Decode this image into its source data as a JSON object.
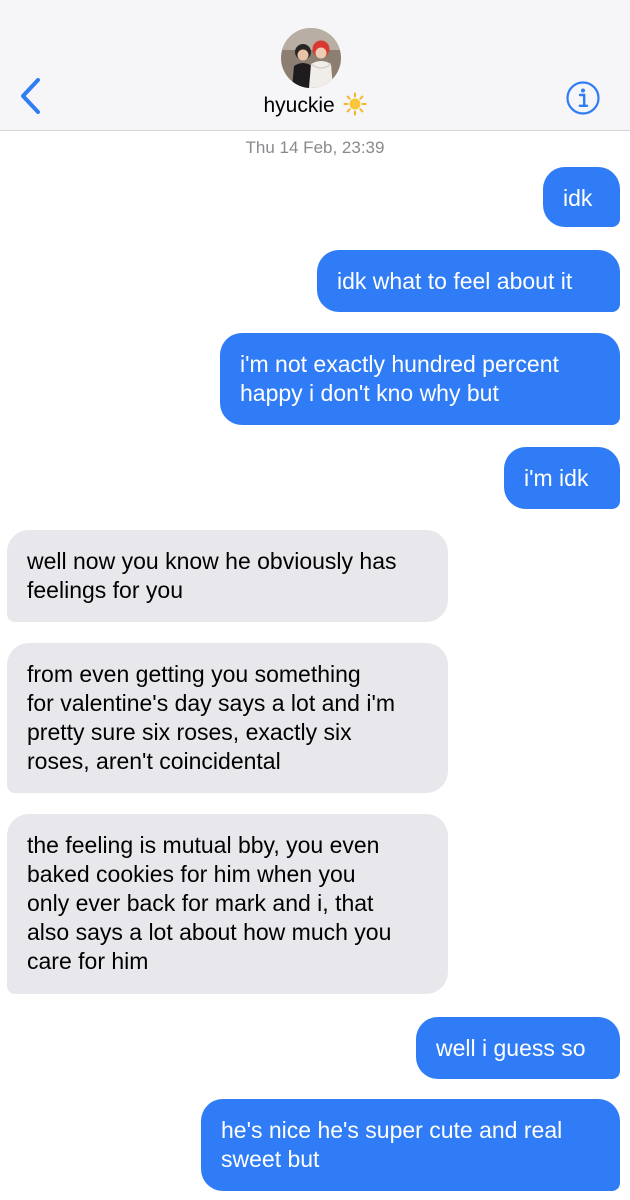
{
  "header": {
    "contact_name": "hyuckie",
    "contact_emoji": "sun-icon",
    "back_icon": "chevron-left-icon",
    "info_icon": "info-circle-icon",
    "accent_color": "#2f7cf6"
  },
  "thread": {
    "timestamp": "Thu 14 Feb, 23:39",
    "messages": [
      {
        "side": "sent",
        "text": "idk"
      },
      {
        "side": "sent",
        "text": "idk what to feel about it"
      },
      {
        "side": "sent",
        "text": "i'm not exactly hundred percent\nhappy i don't kno why but"
      },
      {
        "side": "sent",
        "text": "i'm idk"
      },
      {
        "side": "received",
        "text": "well now you know he obviously has\nfeelings for you"
      },
      {
        "side": "received",
        "text": "from even getting you something\nfor valentine's day says a lot and i'm\npretty sure six roses, exactly six\nroses, aren't coincidental"
      },
      {
        "side": "received",
        "text": "the feeling is mutual bby, you even\nbaked cookies for him when you\nonly ever back for mark and i, that\nalso says a lot about how much you\ncare for him"
      },
      {
        "side": "sent",
        "text": "well i guess so"
      },
      {
        "side": "sent",
        "text": "he's nice he's super cute and real\nsweet but"
      }
    ]
  },
  "colors": {
    "sent_bubble": "#2f7cf6",
    "received_bubble": "#e8e8ec",
    "header_bg": "#f6f6f8"
  }
}
